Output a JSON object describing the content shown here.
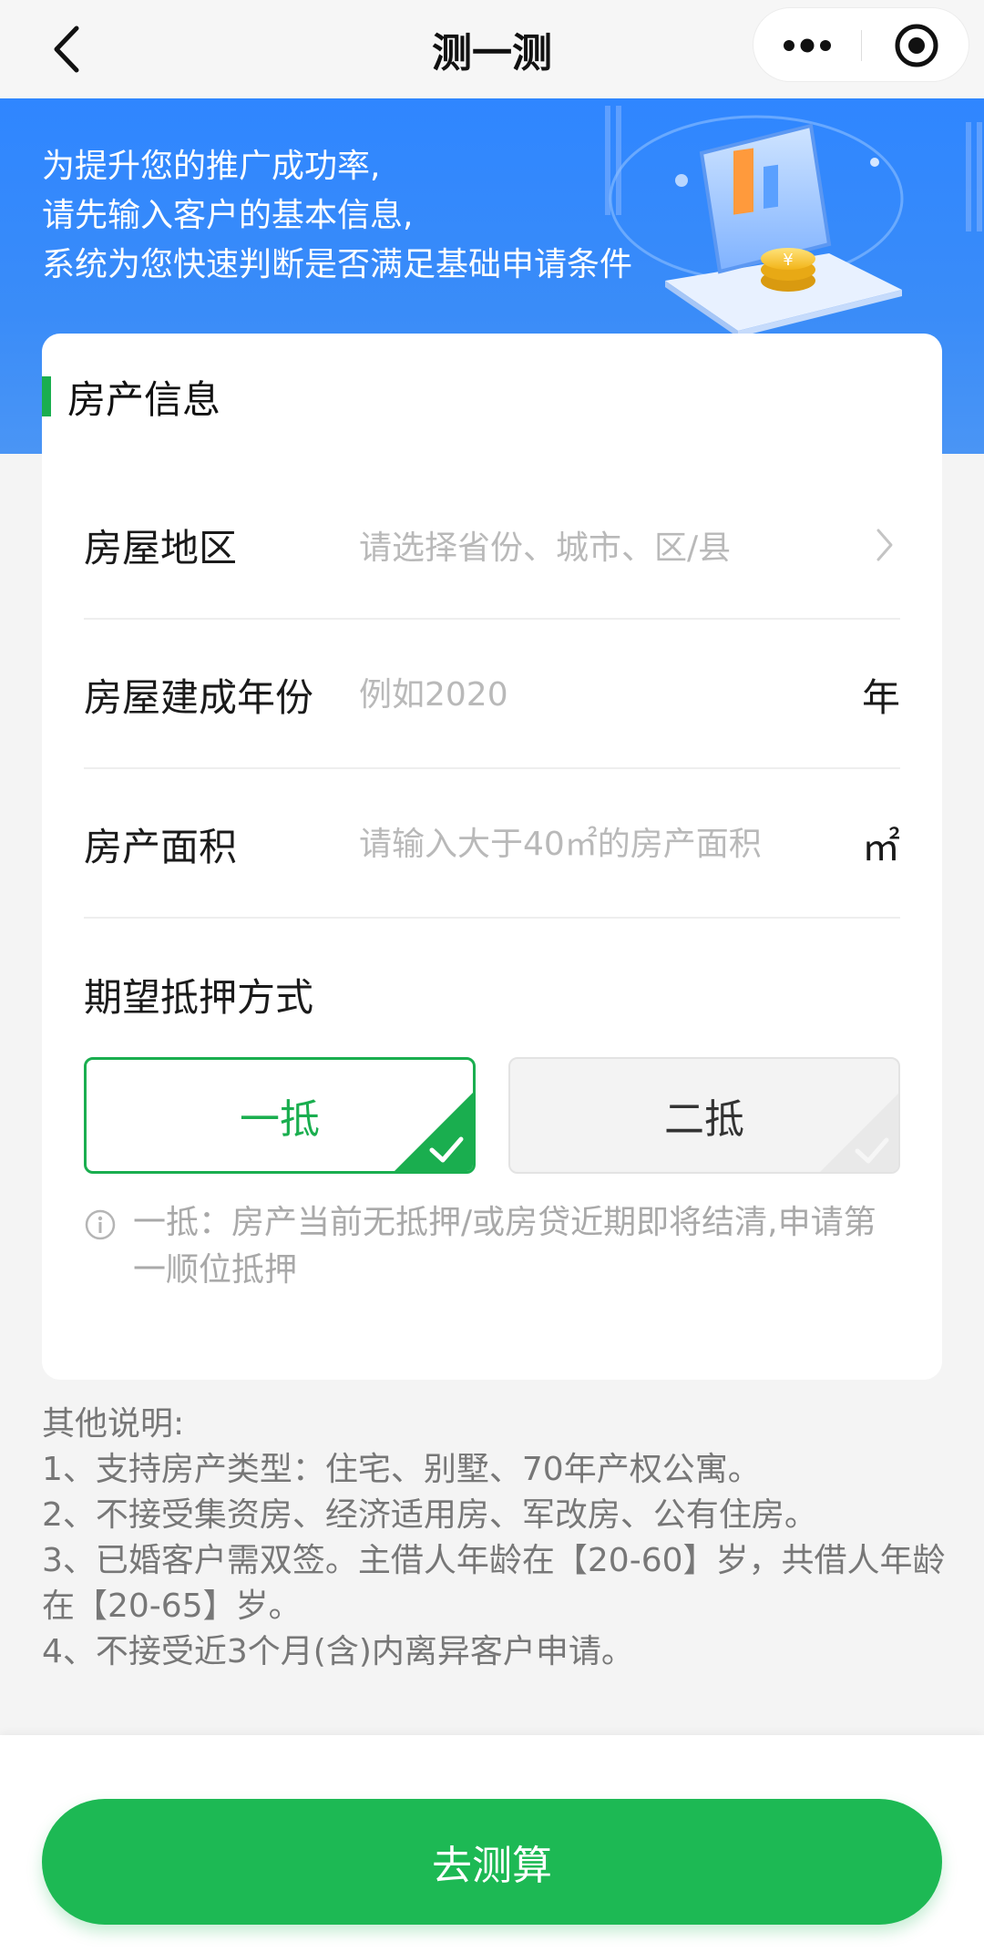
{
  "nav": {
    "title": "测一测",
    "icons": {
      "back": "chevron-left-icon",
      "more": "more-dots-icon",
      "close": "target-circle-icon"
    }
  },
  "banner": {
    "lines": [
      "为提升您的推广成功率,",
      "请先输入客户的基本信息,",
      "系统为您快速判断是否满足基础申请条件"
    ],
    "bg_color": "#2f86ff"
  },
  "form": {
    "section_title": "房产信息",
    "accent_color": "#1aae4f",
    "region": {
      "label": "房屋地区",
      "placeholder": "请选择省份、城市、区/县"
    },
    "year": {
      "label": "房屋建成年份",
      "placeholder": "例如2020",
      "unit": "年"
    },
    "area": {
      "label": "房产面积",
      "placeholder": "请输入大于40㎡的房产面积",
      "unit": "㎡"
    },
    "mortgage": {
      "label": "期望抵押方式",
      "options": [
        {
          "label": "一抵",
          "selected": true
        },
        {
          "label": "二抵",
          "selected": false
        }
      ],
      "note": "一抵：房产当前无抵押/或房贷近期即将结清,申请第一顺位抵押"
    }
  },
  "other_notes": {
    "title": "其他说明:",
    "items": [
      "1、支持房产类型：住宅、别墅、70年产权公寓。",
      "2、不接受集资房、经济适用房、军改房、公有住房。",
      "3、已婚客户需双签。主借人年龄在【20-60】岁，共借人年龄在【20-65】岁。",
      "4、不接受近3个月(含)内离异客户申请。"
    ]
  },
  "submit": {
    "label": "去测算",
    "color": "#1db954"
  }
}
